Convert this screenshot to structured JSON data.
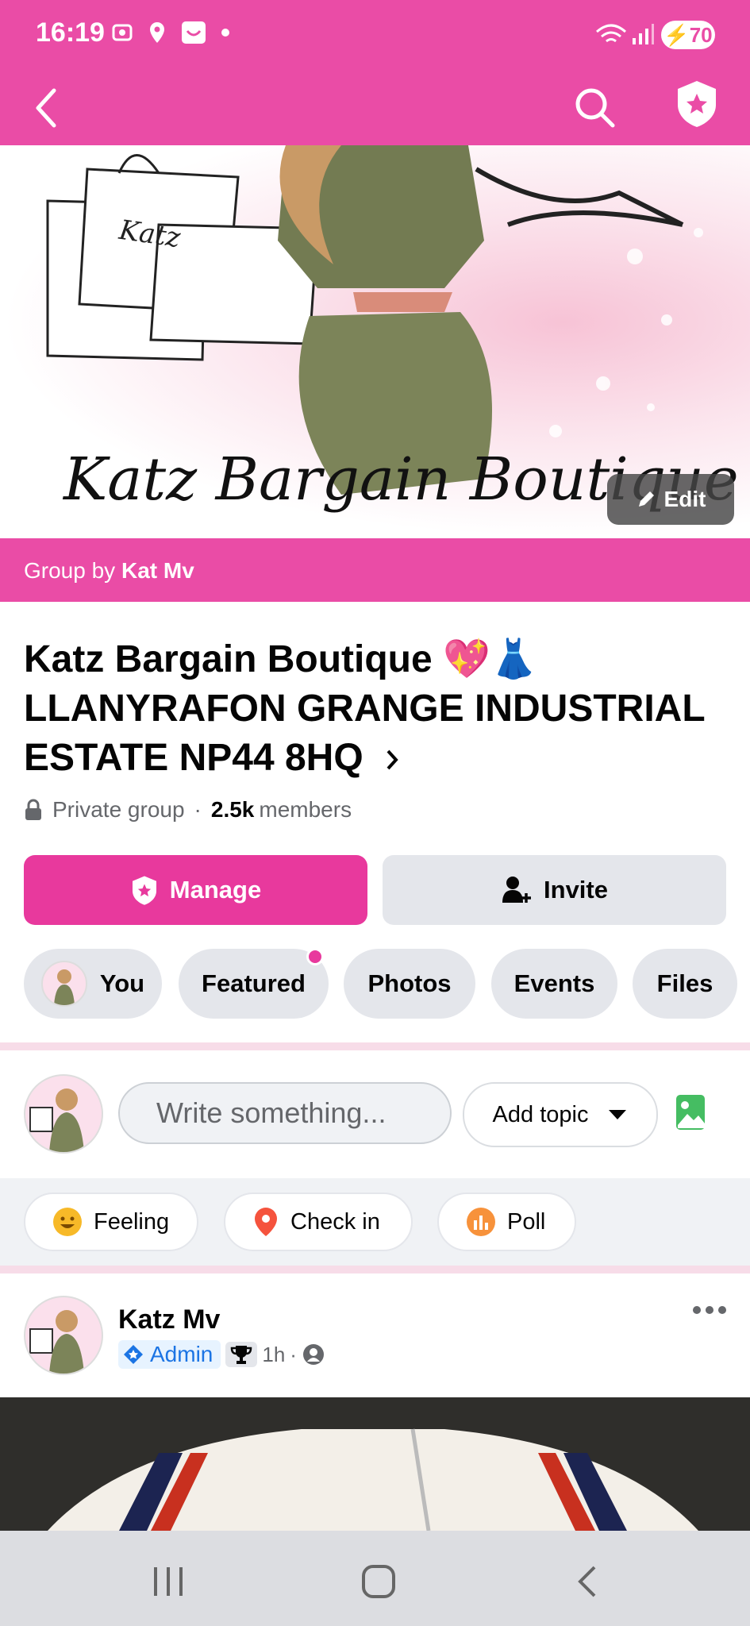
{
  "status_bar": {
    "time": "16:19",
    "battery": "70"
  },
  "header": {
    "back_icon": "back-arrow-icon",
    "search_icon": "search-icon",
    "admin_icon": "shield-star-icon"
  },
  "cover": {
    "title": "Katz Bargain Boutique",
    "bag_label": "Katz",
    "edit_label": "Edit"
  },
  "group_by": {
    "prefix": "Group by ",
    "owner": "Kat Mv"
  },
  "group": {
    "name": "Katz Bargain Boutique 💖👗 LLANYRAFON GRANGE INDUSTRIAL ESTATE NP44 8HQ",
    "privacy": "Private group",
    "separator": "·",
    "members_count": "2.5k",
    "members_label": "members"
  },
  "buttons": {
    "manage": "Manage",
    "invite": "Invite"
  },
  "tabs": [
    {
      "label": "You"
    },
    {
      "label": "Featured"
    },
    {
      "label": "Photos"
    },
    {
      "label": "Events"
    },
    {
      "label": "Files"
    }
  ],
  "composer": {
    "placeholder": "Write something...",
    "add_topic": "Add topic"
  },
  "actions": {
    "feeling": "Feeling",
    "check_in": "Check in",
    "poll": "Poll"
  },
  "post": {
    "author": "Katz Mv",
    "role": "Admin",
    "time": "1h",
    "separator": "·"
  },
  "colors": {
    "brand_pink": "#ea4ca6",
    "button_pink": "#e8399d",
    "gray_button": "#e4e6eb",
    "admin_blue": "#1b74e4"
  }
}
